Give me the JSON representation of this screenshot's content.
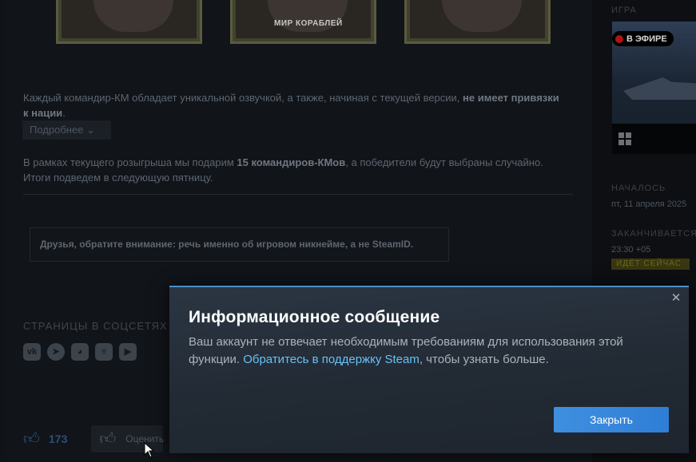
{
  "background": {
    "image_caption": "МИР КОРАБЛЕЙ",
    "paragraph1": {
      "text": "Каждый командир-КМ обладает уникальной озвучкой, а также, начиная с текущей версии, ",
      "bold": "не имеет привязки к нации",
      "end": "."
    },
    "more_button": "Подробнее",
    "paragraph2": {
      "start": "В рамках текущего розыгрыша мы подарим ",
      "bold": "15 командиров-КМов",
      "end": ", а победители будут выбраны случайно. Итоги подведем в следующую пятницу."
    },
    "note": "Друзья, обратите внимание: речь именно об игровом никнейме, а не SteamID.",
    "social_title": "СТРАНИЦЫ В СОЦСЕТЯХ",
    "social_icons": [
      "vk-icon",
      "telegram-icon",
      "discord-icon",
      "twitch-icon",
      "youtube-icon"
    ],
    "like_count": "173",
    "rate_label": "Оценить"
  },
  "sidebar": {
    "game_label": "ИГРА",
    "live_badge": "В ЭФИРЕ",
    "started_label": "НАЧАЛОСЬ",
    "started_value": "пт, 11 апреля 2025",
    "ends_label": "ЗАКАНЧИВАЕТСЯ",
    "ends_value": "23:30 +05",
    "status_badge": "ИДЁТ СЕЙЧАС"
  },
  "modal": {
    "title": "Информационное сообщение",
    "body_start": "Ваш аккаунт не отвечает необходимым требованиям для использования этой функции. ",
    "link_text": "Обратитесь в поддержку Steam",
    "body_end": ", чтобы узнать больше.",
    "close_glyph": "✕",
    "button_label": "Закрыть"
  },
  "colors": {
    "accent": "#67c1f5",
    "button": "#3f8fe0",
    "modal_bg": "#222a34"
  }
}
